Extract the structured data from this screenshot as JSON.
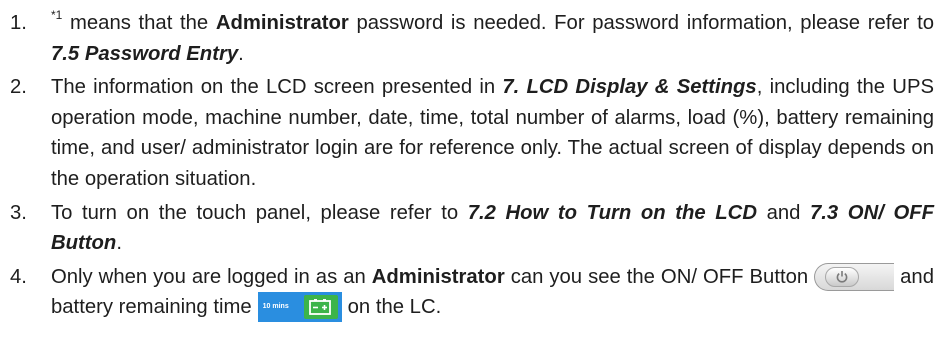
{
  "notes": [
    {
      "number": "1.",
      "superscript": "*1",
      "t1": " means that the ",
      "admin": "Administrator",
      "t2": " password is needed. For password information, please refer to ",
      "ref": "7.5 Password Entry",
      "t3": "."
    },
    {
      "number": "2.",
      "t1": "The information on the LCD screen presented in ",
      "ref": "7. LCD Display & Settings",
      "t2": ", including the UPS operation mode, machine number, date, time, total number of alarms, load (%), battery remaining time, and user/ administrator login are for reference only. The actual screen of display depends on the operation situation."
    },
    {
      "number": "3.",
      "t1": "To turn on the touch panel, please refer to ",
      "ref1": "7.2 How to Turn on the LCD",
      "t2": " and ",
      "ref2": "7.3 ON/ OFF Button",
      "t3": "."
    },
    {
      "number": "4.",
      "t1": "Only when you are logged in as an ",
      "admin": "Administrator",
      "t2": " can you see the ON/ OFF Button",
      "t3": "and battery remaining time",
      "t4": "on the LC."
    }
  ],
  "icons": {
    "onoff_button": "power-icon",
    "battery_time": "battery-icon",
    "battery_label": "10 mins"
  },
  "colors": {
    "text": "#1e1e1e",
    "battery_bg": "#2a8ee0",
    "battery_cell": "#3cb44a"
  }
}
